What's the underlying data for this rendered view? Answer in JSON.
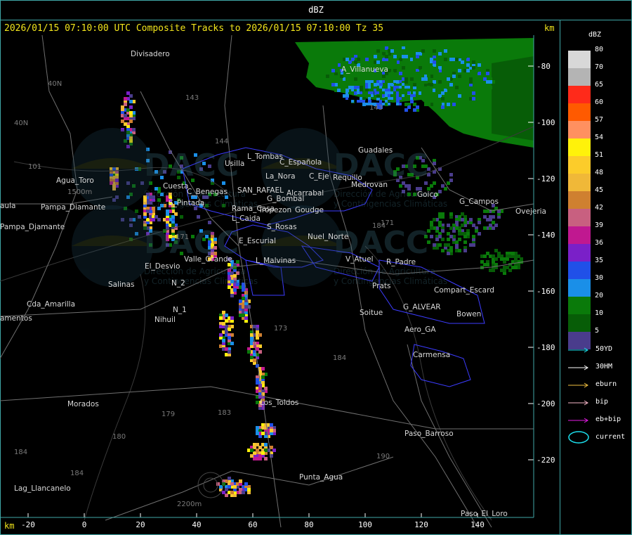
{
  "product": "dBZ",
  "header": "2026/01/15 07:10:00 UTC Composite Tracks to 2026/01/15 07:10:00 Tz 35",
  "km_unit": "km",
  "colors": {
    "frame": "#3fa7a7",
    "header": "#f2e51c",
    "places": "#d8d8d8",
    "roads": "#6f6f6f",
    "boundary": "#3c3cff",
    "rivers": "#3a3a3a"
  },
  "y_ticks": [
    "-80",
    "-100",
    "-120",
    "-140",
    "-160",
    "-180",
    "-200",
    "-220"
  ],
  "x_ticks": [
    "-20",
    "0",
    "20",
    "40",
    "60",
    "80",
    "100",
    "120",
    "140"
  ],
  "dbz_scale": [
    {
      "label": "80",
      "color": "#d8d8d8"
    },
    {
      "label": "70",
      "color": "#b4b4b4"
    },
    {
      "label": "65",
      "color": "#ff2a1a"
    },
    {
      "label": "60",
      "color": "#ff5a00"
    },
    {
      "label": "57",
      "color": "#ff9060"
    },
    {
      "label": "54",
      "color": "#fff20a"
    },
    {
      "label": "51",
      "color": "#fccc2a"
    },
    {
      "label": "48",
      "color": "#f0b838"
    },
    {
      "label": "45",
      "color": "#cf8030"
    },
    {
      "label": "42",
      "color": "#c86080"
    },
    {
      "label": "39",
      "color": "#c01890"
    },
    {
      "label": "36",
      "color": "#7a20c8"
    },
    {
      "label": "35",
      "color": "#2050e8"
    },
    {
      "label": "30",
      "color": "#1a8fe8"
    },
    {
      "label": "20",
      "color": "#0a7a0a"
    },
    {
      "label": "10",
      "color": "#075d07"
    },
    {
      "label": "5",
      "color": "#4a3c8c"
    }
  ],
  "tracks_legend": [
    {
      "label": "50YD",
      "color": "#1ce0ee"
    },
    {
      "label": "30HM",
      "color": "#ffffff"
    },
    {
      "label": "eburn",
      "color": "#f2c040"
    },
    {
      "label": "bip",
      "color": "#f6b6c8"
    },
    {
      "label": "eb+bip",
      "color": "#e81ce8"
    },
    {
      "label": "current",
      "color": "#1ce0ee"
    }
  ],
  "places": [
    {
      "name": "Divisadero"
    },
    {
      "name": "A_Villanueva"
    },
    {
      "name": "Guadales"
    },
    {
      "name": "Agua_Toro"
    },
    {
      "name": "Usilla"
    },
    {
      "name": "L_Tombas"
    },
    {
      "name": "C_Española"
    },
    {
      "name": "La_Nora"
    },
    {
      "name": "C_Eje"
    },
    {
      "name": "Requillo"
    },
    {
      "name": "Medrovan"
    },
    {
      "name": "C_Benegas"
    },
    {
      "name": "SAN_RAFAEL"
    },
    {
      "name": "Alcarrabal"
    },
    {
      "name": "S_Pintada"
    },
    {
      "name": "Cuesta"
    },
    {
      "name": "Pampa_Diamante"
    },
    {
      "name": "Pampa_Djamante"
    },
    {
      "name": "aula"
    },
    {
      "name": "Cda_Amarilla"
    },
    {
      "name": "amentos"
    },
    {
      "name": "Salinas"
    },
    {
      "name": "El_Desvio"
    },
    {
      "name": "N_2"
    },
    {
      "name": "N_1"
    },
    {
      "name": "Nihuil"
    },
    {
      "name": "Valle_Grande"
    },
    {
      "name": "L_Malvinas"
    },
    {
      "name": "E_Escurial"
    },
    {
      "name": "L_Caida"
    },
    {
      "name": "S_Rosas"
    },
    {
      "name": "Nuel_Norte"
    },
    {
      "name": "V_Atuel"
    },
    {
      "name": "R_Padre"
    },
    {
      "name": "Prats"
    },
    {
      "name": "Compart_Escard"
    },
    {
      "name": "G_ALVEAR"
    },
    {
      "name": "Soitue"
    },
    {
      "name": "Bowen"
    },
    {
      "name": "Aero_GA"
    },
    {
      "name": "Carmensa"
    },
    {
      "name": "Los_Toldos"
    },
    {
      "name": "Morados"
    },
    {
      "name": "Paso_Barroso"
    },
    {
      "name": "Punta_Agua"
    },
    {
      "name": "Lag_Llancanelo"
    },
    {
      "name": "Paso_El_Loro"
    },
    {
      "name": "Goico"
    },
    {
      "name": "G_Campos"
    },
    {
      "name": "Ovejeria"
    },
    {
      "name": "G_Bombal"
    },
    {
      "name": "Tropezon"
    },
    {
      "name": "Goudge"
    },
    {
      "name": "Rama_Casa"
    }
  ],
  "road_numbers": [
    "40N",
    "40N",
    "101",
    "143",
    "143",
    "144",
    "171",
    "171",
    "173",
    "179",
    "180",
    "183",
    "184",
    "184",
    "184",
    "184",
    "190"
  ],
  "elevation_labels": [
    "1500m",
    "2200m"
  ],
  "watermark": {
    "logo_text": "DACC",
    "line1": "Dirección de Agricultura",
    "line2": "y Contingencias Climáticas"
  }
}
